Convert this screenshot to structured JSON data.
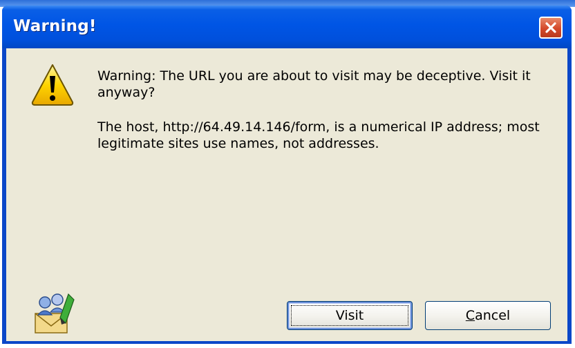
{
  "window": {
    "title": "Warning!"
  },
  "message": {
    "line1": "Warning: The URL you are about to visit may be deceptive. Visit it anyway?",
    "line2": "The host, http://64.49.14.146/form, is a numerical IP address; most legitimate sites use names, not addresses."
  },
  "buttons": {
    "visit_label": "Visit",
    "cancel_label_accel": "C",
    "cancel_label_rest": "ancel"
  },
  "icons": {
    "warning": "warning-triangle-icon",
    "app": "mail-people-icon",
    "close": "close-x-icon"
  },
  "colors": {
    "titlebar": "#0055e5",
    "client_bg": "#ece9d8",
    "close_button": "#d4492a"
  }
}
